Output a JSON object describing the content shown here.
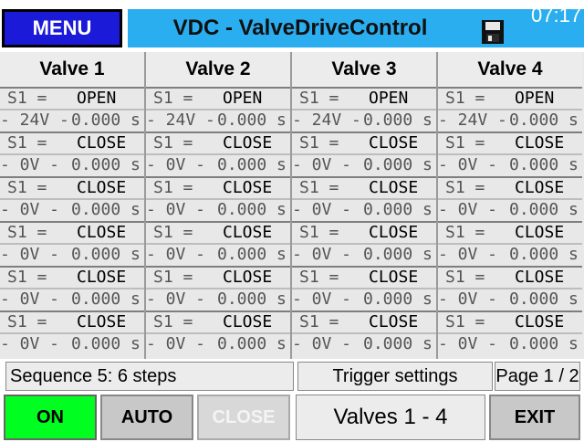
{
  "header": {
    "menu_label": "MENU",
    "title": "VDC - ValveDriveControl",
    "time": "07:17",
    "save_icon": "floppy-disk-icon"
  },
  "valves": [
    {
      "name": "Valve 1",
      "steps": [
        {
          "s1": "S1 =",
          "state": "OPEN",
          "voltage": "- 24V -",
          "time": "0.000  s"
        },
        {
          "s1": "S1 =",
          "state": "CLOSE",
          "voltage": "- 0V -",
          "time": "0.000  s"
        },
        {
          "s1": "S1 =",
          "state": "CLOSE",
          "voltage": "- 0V -",
          "time": "0.000  s"
        },
        {
          "s1": "S1 =",
          "state": "CLOSE",
          "voltage": "- 0V -",
          "time": "0.000  s"
        },
        {
          "s1": "S1 =",
          "state": "CLOSE",
          "voltage": "- 0V -",
          "time": "0.000  s"
        },
        {
          "s1": "S1 =",
          "state": "CLOSE",
          "voltage": "- 0V -",
          "time": "0.000  s"
        }
      ]
    },
    {
      "name": "Valve 2",
      "steps": [
        {
          "s1": "S1 =",
          "state": "OPEN",
          "voltage": "- 24V -",
          "time": "0.000  s"
        },
        {
          "s1": "S1 =",
          "state": "CLOSE",
          "voltage": "- 0V -",
          "time": "0.000  s"
        },
        {
          "s1": "S1 =",
          "state": "CLOSE",
          "voltage": "- 0V -",
          "time": "0.000  s"
        },
        {
          "s1": "S1 =",
          "state": "CLOSE",
          "voltage": "- 0V -",
          "time": "0.000  s"
        },
        {
          "s1": "S1 =",
          "state": "CLOSE",
          "voltage": "- 0V -",
          "time": "0.000  s"
        },
        {
          "s1": "S1 =",
          "state": "CLOSE",
          "voltage": "- 0V -",
          "time": "0.000  s"
        }
      ]
    },
    {
      "name": "Valve 3",
      "steps": [
        {
          "s1": "S1 =",
          "state": "OPEN",
          "voltage": "- 24V -",
          "time": "0.000  s"
        },
        {
          "s1": "S1 =",
          "state": "CLOSE",
          "voltage": "- 0V -",
          "time": "0.000  s"
        },
        {
          "s1": "S1 =",
          "state": "CLOSE",
          "voltage": "- 0V -",
          "time": "0.000  s"
        },
        {
          "s1": "S1 =",
          "state": "CLOSE",
          "voltage": "- 0V -",
          "time": "0.000  s"
        },
        {
          "s1": "S1 =",
          "state": "CLOSE",
          "voltage": "- 0V -",
          "time": "0.000  s"
        },
        {
          "s1": "S1 =",
          "state": "CLOSE",
          "voltage": "- 0V -",
          "time": "0.000  s"
        }
      ]
    },
    {
      "name": "Valve 4",
      "steps": [
        {
          "s1": "S1 =",
          "state": "OPEN",
          "voltage": "- 24V -",
          "time": "0.000  s"
        },
        {
          "s1": "S1 =",
          "state": "CLOSE",
          "voltage": "- 0V -",
          "time": "0.000  s"
        },
        {
          "s1": "S1 =",
          "state": "CLOSE",
          "voltage": "- 0V -",
          "time": "0.000  s"
        },
        {
          "s1": "S1 =",
          "state": "CLOSE",
          "voltage": "- 0V -",
          "time": "0.000  s"
        },
        {
          "s1": "S1 =",
          "state": "CLOSE",
          "voltage": "- 0V -",
          "time": "0.000  s"
        },
        {
          "s1": "S1 =",
          "state": "CLOSE",
          "voltage": "- 0V -",
          "time": "0.000  s"
        }
      ]
    }
  ],
  "status": {
    "sequence": "Sequence 5: 6 steps",
    "trigger": "Trigger settings",
    "page": "Page 1 / 2"
  },
  "buttons": {
    "on": "ON",
    "auto": "AUTO",
    "close": "CLOSE",
    "valves_range": "Valves  1 -  4",
    "exit": "EXIT"
  },
  "colors": {
    "menu_bg": "#1a1ad8",
    "title_bg": "#2aaef0",
    "on_bg": "#00ff20"
  }
}
